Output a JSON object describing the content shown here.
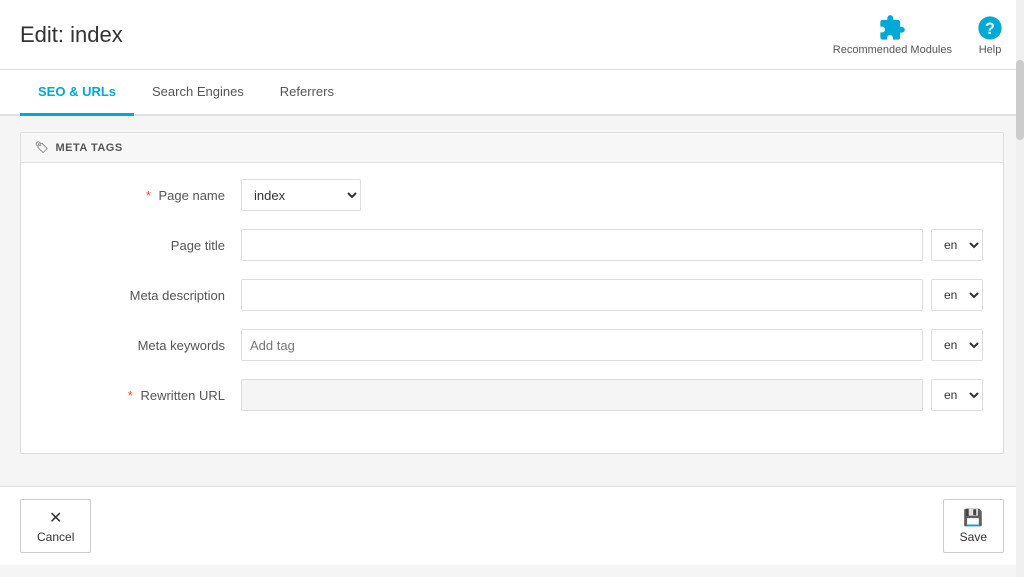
{
  "header": {
    "title": "Edit: index",
    "actions": [
      {
        "id": "recommended-modules",
        "label": "Recommended Modules",
        "icon": "puzzle-icon"
      },
      {
        "id": "help",
        "label": "Help",
        "icon": "help-icon"
      }
    ]
  },
  "tabs": [
    {
      "id": "seo-urls",
      "label": "SEO & URLs",
      "active": true
    },
    {
      "id": "search-engines",
      "label": "Search Engines",
      "active": false
    },
    {
      "id": "referrers",
      "label": "Referrers",
      "active": false
    }
  ],
  "section": {
    "title": "META TAGS",
    "tag_icon": "tag-icon"
  },
  "form": {
    "fields": [
      {
        "id": "page-name",
        "label": "Page name",
        "required": true,
        "type": "select",
        "value": "index",
        "options": [
          "index"
        ]
      },
      {
        "id": "page-title",
        "label": "Page title",
        "required": false,
        "type": "text-lang",
        "value": "",
        "placeholder": "",
        "lang": "en"
      },
      {
        "id": "meta-description",
        "label": "Meta description",
        "required": false,
        "type": "text-lang",
        "value": "",
        "placeholder": "",
        "lang": "en"
      },
      {
        "id": "meta-keywords",
        "label": "Meta keywords",
        "required": false,
        "type": "tags-lang",
        "placeholder": "Add tag",
        "lang": "en"
      },
      {
        "id": "rewritten-url",
        "label": "Rewritten URL",
        "required": true,
        "type": "text-lang-disabled",
        "value": "",
        "placeholder": "",
        "lang": "en"
      }
    ]
  },
  "footer": {
    "cancel_label": "Cancel",
    "save_label": "Save"
  },
  "colors": {
    "accent": "#00aad4",
    "required": "#e74c3c"
  }
}
